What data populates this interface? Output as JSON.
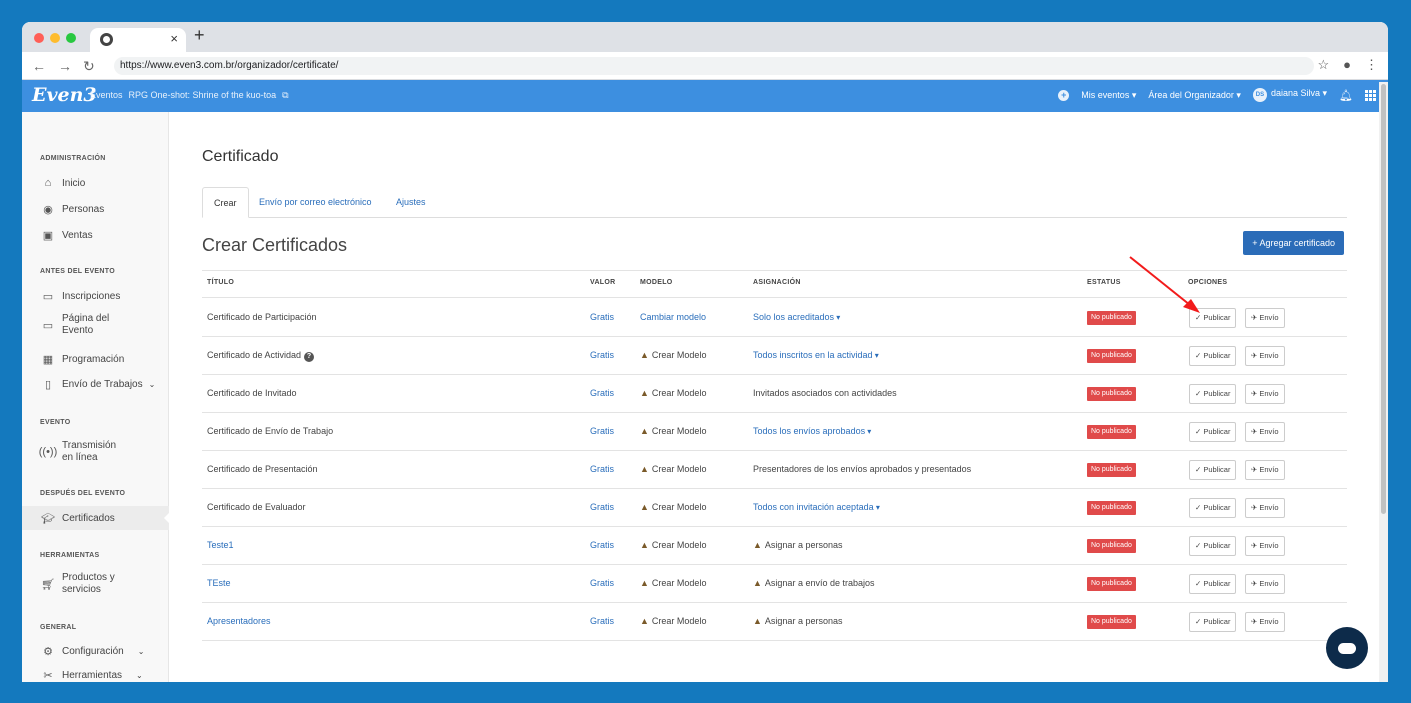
{
  "browser": {
    "url": "https://www.even3.com.br/organizador/certificate/",
    "traffic_colors": [
      "#ff5f57",
      "#febc2e",
      "#28c840"
    ]
  },
  "header": {
    "logo": "Even3",
    "crumb_events": "Eventos",
    "crumb_event_name": "RPG One-shot: Shrine of the kuo-toa",
    "my_events": "Mis eventos",
    "org_area": "Área del Organizador",
    "avatar_initials": "DS",
    "user_name": "daiana Silva"
  },
  "sidebar": {
    "administracion": "ADMINISTRACIÓN",
    "inicio": "Inicio",
    "personas": "Personas",
    "ventas": "Ventas",
    "antes": "ANTES DEL EVENTO",
    "inscripciones": "Inscripciones",
    "pagina1": "Página del",
    "pagina2": "Evento",
    "programacion": "Programación",
    "envio_trabajos": "Envío de Trabajos",
    "evento": "EVENTO",
    "transmision1": "Transmisión",
    "transmision2": "en línea",
    "despues": "DESPUÉS DEL EVENTO",
    "certificados": "Certificados",
    "herramientas_sec": "HERRAMIENTAS",
    "productos1": "Productos y",
    "productos2": "servicios",
    "general": "GENERAL",
    "configuracion": "Configuración",
    "herramientas": "Herramientas"
  },
  "main": {
    "page_title": "Certificado",
    "tabs": [
      "Crear",
      "Envío por correo electrónico",
      "Ajustes"
    ],
    "section_title": "Crear Certificados",
    "add_button": "+ Agregar certificado",
    "columns": {
      "titulo": "TÍTULO",
      "valor": "VALOR",
      "modelo": "MODELO",
      "asignacion": "ASIGNACIÓN",
      "estatus": "ESTATUS",
      "opciones": "OPCIONES"
    },
    "status_label": "No publicado",
    "publish_label": "✓ Publicar",
    "send_label": "✈ Envío",
    "rows": [
      {
        "title": "Certificado de Participación",
        "valor": "Gratis",
        "modelo": "Cambiar modelo",
        "asignacion": "Solo los acreditados"
      },
      {
        "title": "Certificado de Actividad",
        "valor": "Gratis",
        "modelo": "Crear Modelo",
        "asignacion": "Todos inscritos en la actividad"
      },
      {
        "title": "Certificado de Invitado",
        "valor": "Gratis",
        "modelo": "Crear Modelo",
        "asignacion": "Invitados asociados con actividades"
      },
      {
        "title": "Certificado de Envío de Trabajo",
        "valor": "Gratis",
        "modelo": "Crear Modelo",
        "asignacion": "Todos los envíos aprobados"
      },
      {
        "title": "Certificado de Presentación",
        "valor": "Gratis",
        "modelo": "Crear Modelo",
        "asignacion": "Presentadores de los envíos aprobados y presentados"
      },
      {
        "title": "Certificado de Evaluador",
        "valor": "Gratis",
        "modelo": "Crear Modelo",
        "asignacion": "Todos con invitación aceptada"
      },
      {
        "title": "Teste1",
        "valor": "Gratis",
        "modelo": "Crear Modelo",
        "asignacion": "Asignar a personas"
      },
      {
        "title": "TEste",
        "valor": "Gratis",
        "modelo": "Crear Modelo",
        "asignacion": "Asignar a envío de trabajos"
      },
      {
        "title": "Apresentadores",
        "valor": "Gratis",
        "modelo": "Crear Modelo",
        "asignacion": "Asignar a personas"
      }
    ]
  }
}
